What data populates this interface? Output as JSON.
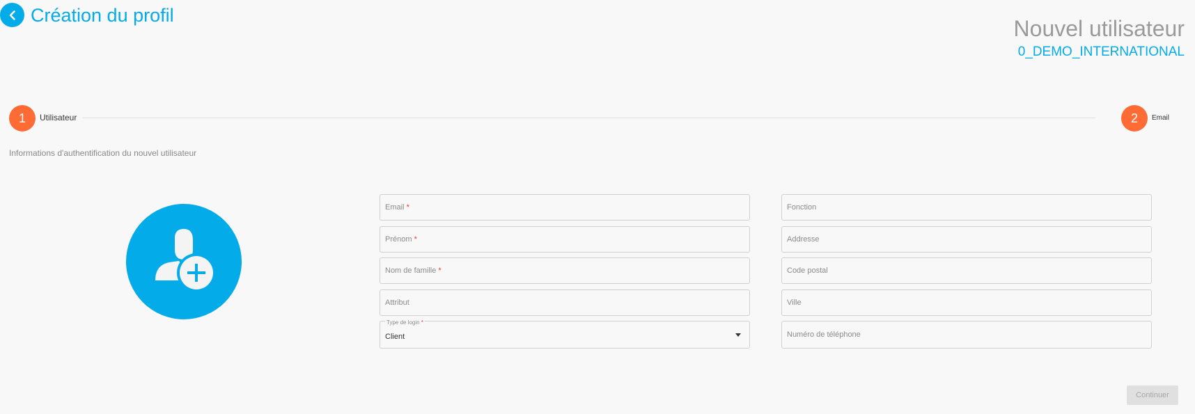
{
  "header": {
    "page_title": "Création du profil",
    "title": "Nouvel utilisateur",
    "subtitle": "0_DEMO_INTERNATIONAL"
  },
  "stepper": {
    "steps": [
      {
        "number": "1",
        "label": "Utilisateur"
      },
      {
        "number": "2",
        "label": "Email"
      }
    ]
  },
  "form": {
    "info": "Informations d'authentification du nouvel utilisateur",
    "required_mark": "*",
    "left_fields": [
      {
        "label": "Email",
        "required": true
      },
      {
        "label": "Prénom",
        "required": true
      },
      {
        "label": "Nom de famille",
        "required": true
      },
      {
        "label": "Attribut",
        "required": false
      }
    ],
    "login_type": {
      "label": "Type de login",
      "value": "Client"
    },
    "right_fields": [
      {
        "label": "Fonction"
      },
      {
        "label": "Addresse"
      },
      {
        "label": "Code postal"
      },
      {
        "label": "Ville"
      },
      {
        "label": "Numéro de téléphone"
      }
    ],
    "continue_label": "Continuer"
  },
  "colors": {
    "accent": "#03abe9",
    "step": "#fe6b34",
    "required": "#e53935"
  },
  "icons": {
    "back": "chevron-left-icon",
    "avatar": "add-user-icon",
    "caret": "caret-down-icon"
  }
}
